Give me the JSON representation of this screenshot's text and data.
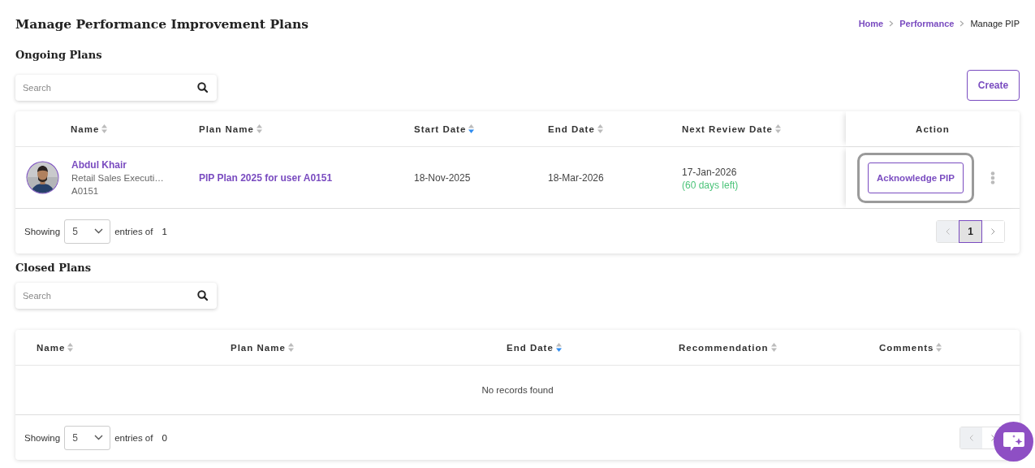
{
  "page_title": "Manage Performance Improvement Plans",
  "breadcrumb": [
    {
      "label": "Home",
      "kind": "link"
    },
    {
      "label": "Performance",
      "kind": "link"
    },
    {
      "label": "Manage PIP",
      "kind": "current"
    }
  ],
  "ongoing": {
    "heading": "Ongoing Plans",
    "search": {
      "placeholder": "Search"
    },
    "create_button": "Create",
    "table": {
      "columns": [
        {
          "label": "Name",
          "sorted": false
        },
        {
          "label": "Plan Name",
          "sorted": false
        },
        {
          "label": "Start Date",
          "sorted": true
        },
        {
          "label": "End Date",
          "sorted": false
        },
        {
          "label": "Next Review Date",
          "sorted": false
        }
      ],
      "action_column": "Action",
      "rows": [
        {
          "name": "Abdul Khair",
          "role": "Retail Sales Executi…",
          "code": "A0151",
          "plan_name": "PIP Plan 2025 for user A0151",
          "start_date": "18-Nov-2025",
          "end_date": "18-Mar-2026",
          "next_review_date": "17-Jan-2026",
          "days_left": "(60 days left)",
          "action_button": {
            "label": "Acknowledge PIP",
            "focused": true
          }
        }
      ]
    },
    "footer": {
      "showing": "Showing",
      "page_size": "5",
      "entries_of": "entries of",
      "total": "1"
    },
    "pagination": {
      "prev_disabled": true,
      "pages": [
        {
          "label": "1",
          "selected": true
        }
      ],
      "next_disabled": false
    }
  },
  "closed": {
    "heading": "Closed Plans",
    "search": {
      "placeholder": "Search"
    },
    "table": {
      "columns": [
        {
          "label": "Name",
          "sorted": false
        },
        {
          "label": "Plan Name",
          "sorted": false
        },
        {
          "label": "End Date",
          "sorted": true
        },
        {
          "label": "Recommendation",
          "sorted": false
        },
        {
          "label": "Comments",
          "sorted": false
        }
      ],
      "empty_message": "No records found"
    },
    "footer": {
      "showing": "Showing",
      "page_size": "5",
      "entries_of": "entries of",
      "total": "0"
    },
    "pagination": {
      "prev_disabled": true,
      "next_disabled": false
    }
  }
}
